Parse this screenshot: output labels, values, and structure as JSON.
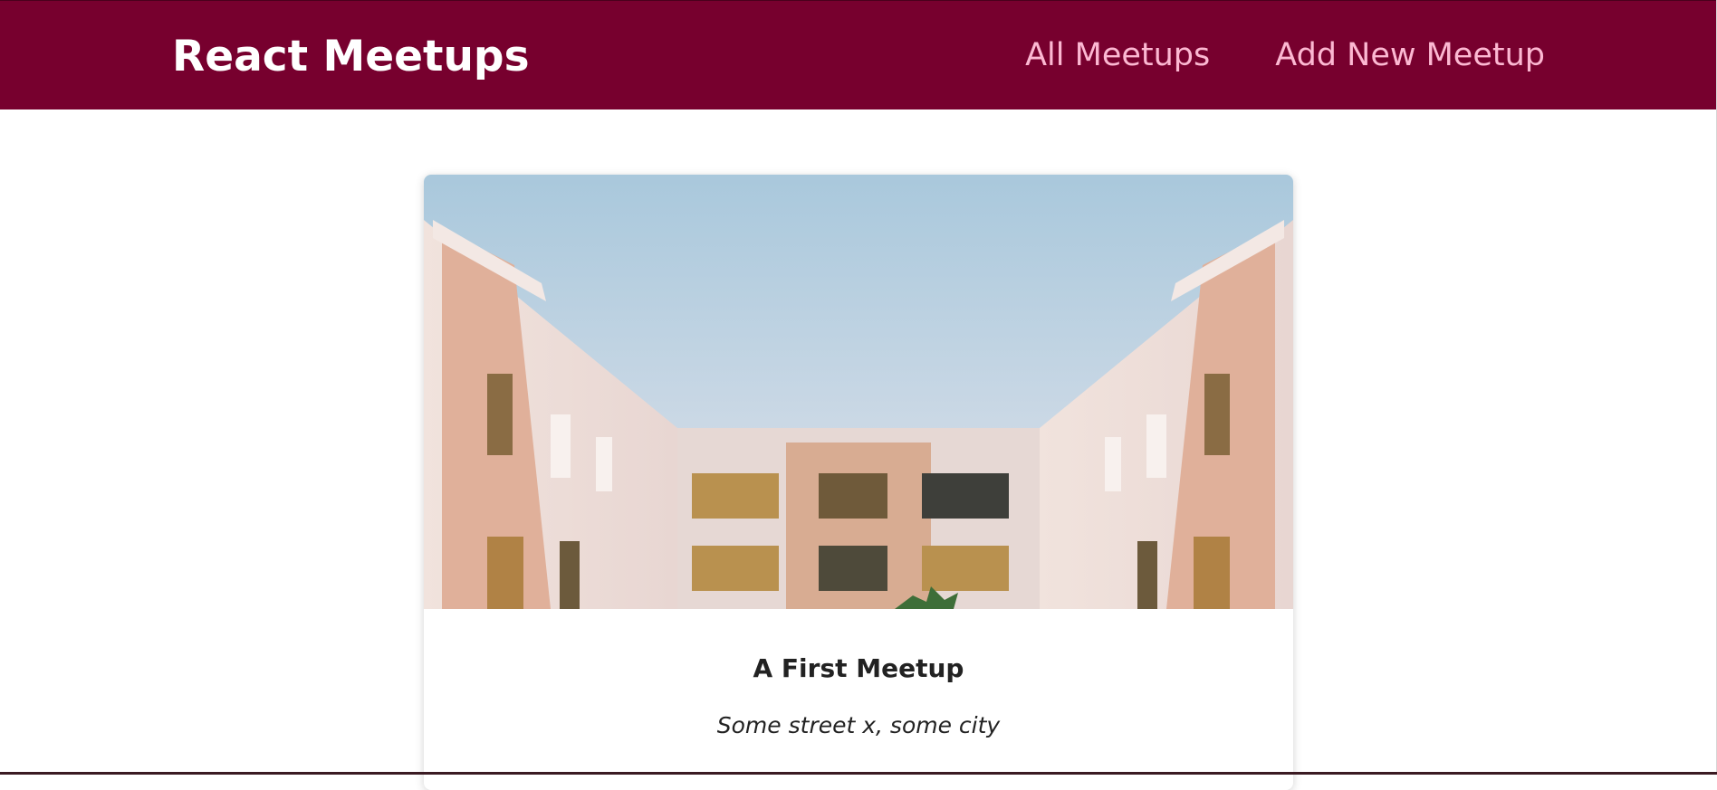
{
  "header": {
    "logo": "React Meetups",
    "nav": [
      {
        "label": "All Meetups"
      },
      {
        "label": "Add New Meetup"
      }
    ]
  },
  "meetup": {
    "title": "A First Meetup",
    "address": "Some street x, some city",
    "image_icon": "building-photo"
  },
  "colors": {
    "header_bg": "#77002e",
    "nav_link": "#fcb8d2",
    "logo": "#ffffff"
  }
}
